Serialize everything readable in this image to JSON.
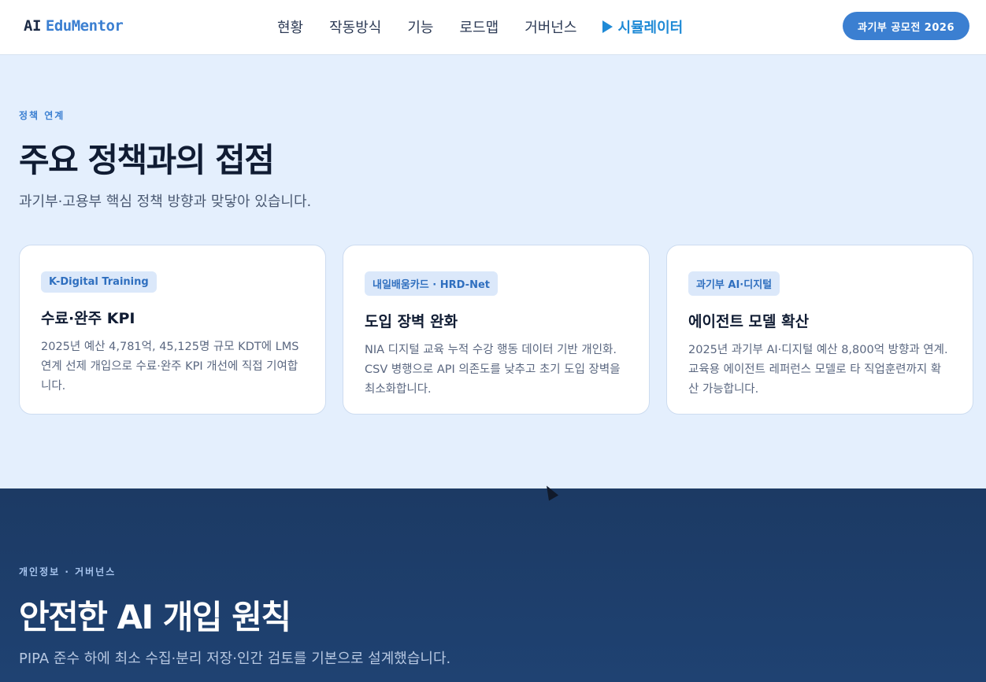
{
  "header": {
    "logo_ai": "AI",
    "logo_brand": "EduMentor",
    "nav": [
      "현황",
      "작동방식",
      "기능",
      "로드맵",
      "거버넌스"
    ],
    "simulator_label": "시뮬레이터",
    "badge": "과기부 공모전 2026"
  },
  "policy": {
    "eyebrow": "정책 연계",
    "title": "주요 정책과의 접점",
    "subtitle": "과기부·고용부 핵심 정책 방향과 맞닿아 있습니다.",
    "cards": [
      {
        "tag": "K-Digital Training",
        "title": "수료·완주 KPI",
        "body": "2025년 예산 4,781억, 45,125명 규모 KDT에 LMS 연계 선제 개입으로 수료·완주 KPI 개선에 직접 기여합니다."
      },
      {
        "tag": "내일배움카드 · HRD-Net",
        "title": "도입 장벽 완화",
        "body": "NIA 디지털 교육 누적 수강 행동 데이터 기반 개인화. CSV 병행으로 API 의존도를 낮추고 초기 도입 장벽을 최소화합니다."
      },
      {
        "tag": "과기부 AI·디지털",
        "title": "에이전트 모델 확산",
        "body": "2025년 과기부 AI·디지털 예산 8,800억 방향과 연계. 교육용 에이전트 레퍼런스 모델로 타 직업훈련까지 확산 가능합니다."
      }
    ]
  },
  "governance": {
    "eyebrow": "개인정보 · 거버넌스",
    "title": "안전한 AI 개입 원칙",
    "subtitle": "PIPA 준수 하에 최소 수집·분리 저장·인간 검토를 기본으로 설계했습니다."
  }
}
